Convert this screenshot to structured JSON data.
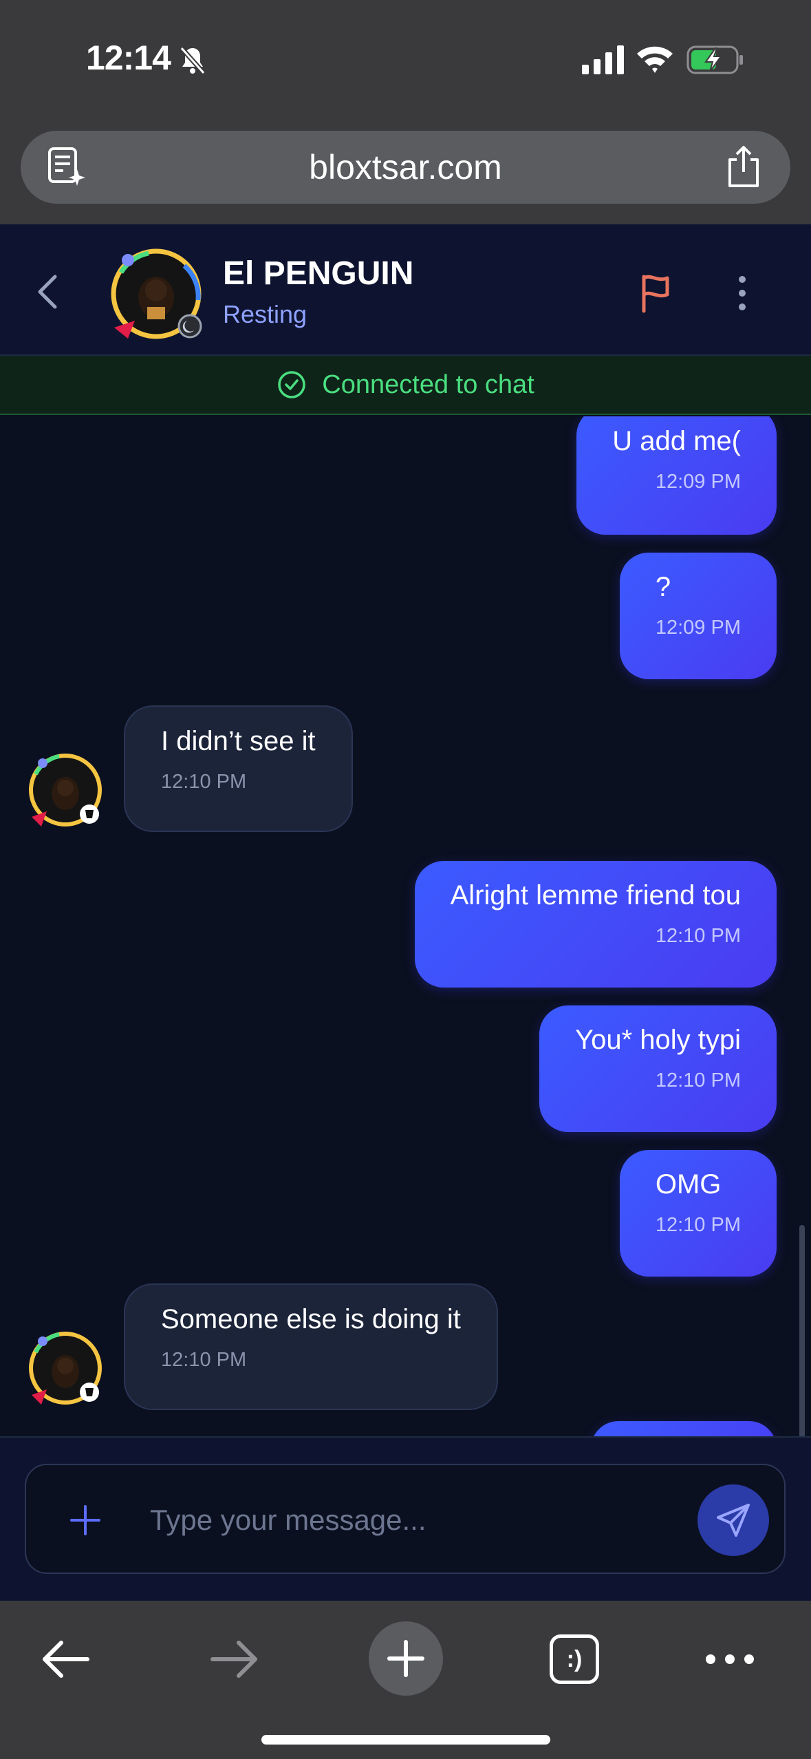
{
  "status_bar": {
    "time": "12:14",
    "icons": [
      "bell-slash-icon",
      "cellular-signal-icon",
      "wifi-icon",
      "battery-charging-icon"
    ]
  },
  "browser": {
    "url": "bloxtsar.com",
    "reader_icon": "page-summary-icon",
    "share_icon": "share-icon"
  },
  "chat_header": {
    "name": "El PENGUIN",
    "status": "Resting",
    "flag_color": "#e8735e"
  },
  "connection": {
    "text": "Connected to chat",
    "color": "#4ade80"
  },
  "messages": [
    {
      "from": "me",
      "text": "U add me(",
      "time": "12:09 PM"
    },
    {
      "from": "me",
      "text": "?",
      "time": "12:09 PM"
    },
    {
      "from": "them",
      "text": "I didn’t see it",
      "time": "12:10 PM"
    },
    {
      "from": "me",
      "text": "Alright lemme friend tou",
      "time": "12:10 PM"
    },
    {
      "from": "me",
      "text": "You* holy typi",
      "time": "12:10 PM"
    },
    {
      "from": "me",
      "text": "OMG",
      "time": "12:10 PM"
    },
    {
      "from": "them",
      "text": "Someone else is doing it",
      "time": "12:10 PM"
    }
  ],
  "composer": {
    "placeholder": "Type your message...",
    "accent": "#5b6cff"
  },
  "toolbar": {
    "items": [
      "back-icon",
      "forward-icon",
      "new-tab-icon",
      "tabs-icon",
      "more-icon"
    ],
    "tabs_label": ":)"
  }
}
